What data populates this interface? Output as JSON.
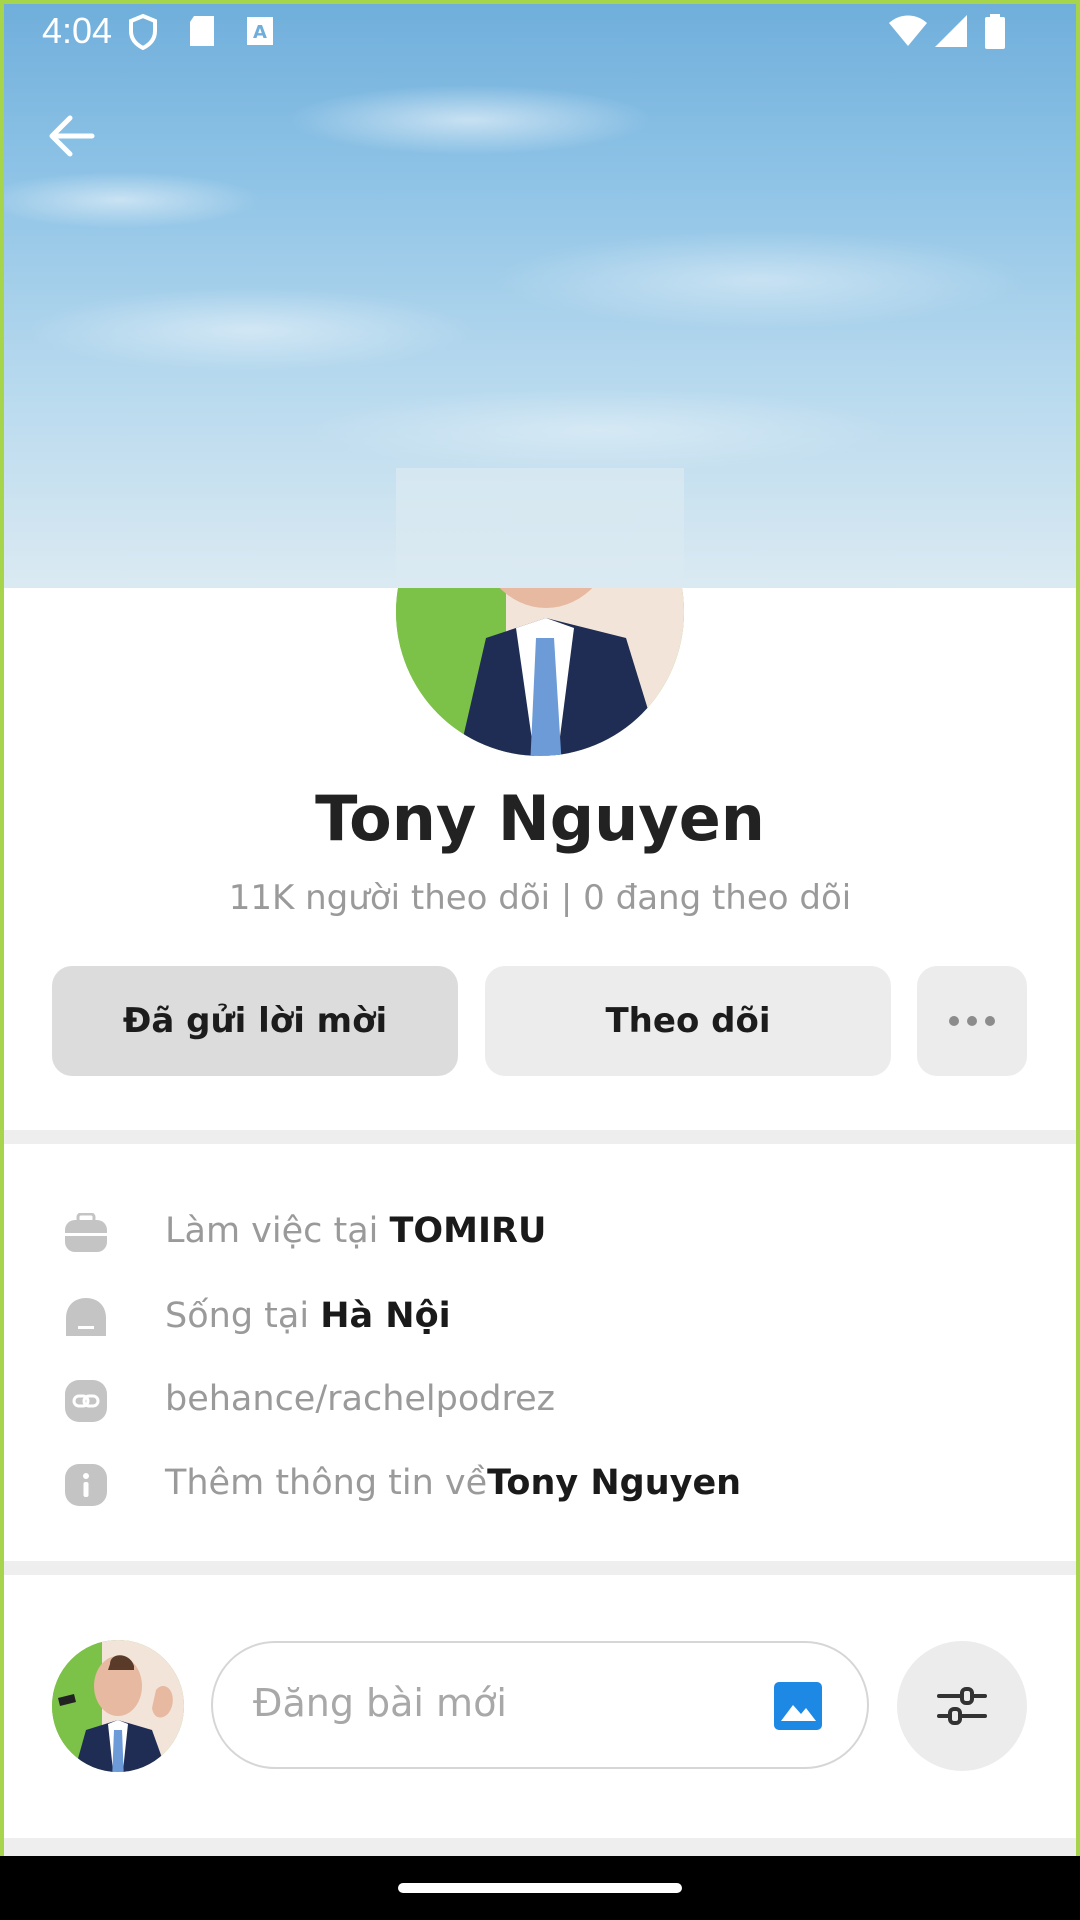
{
  "status_bar": {
    "time": "4:04"
  },
  "profile": {
    "name": "Tony Nguyen",
    "followers_text": "11K người theo dõi | 0 đang theo dõi"
  },
  "actions": {
    "sent_label": "Đã gửi lời mời",
    "follow_label": "Theo dõi",
    "more_label": "•••"
  },
  "info": {
    "work_prefix": "Làm việc tại ",
    "work_value": "TOMIRU",
    "live_prefix": "Sống tại ",
    "live_value": "Hà Nội",
    "link": "behance/rachelpodrez",
    "more_prefix": "Thêm thông tin về",
    "more_value": "Tony Nguyen"
  },
  "composer": {
    "placeholder": "Đăng bài mới"
  },
  "colors": {
    "accent": "#1e88e5",
    "button_sent_bg": "#dcdcdc",
    "button_bg": "#ececec",
    "muted_text": "#9a9a9a"
  }
}
